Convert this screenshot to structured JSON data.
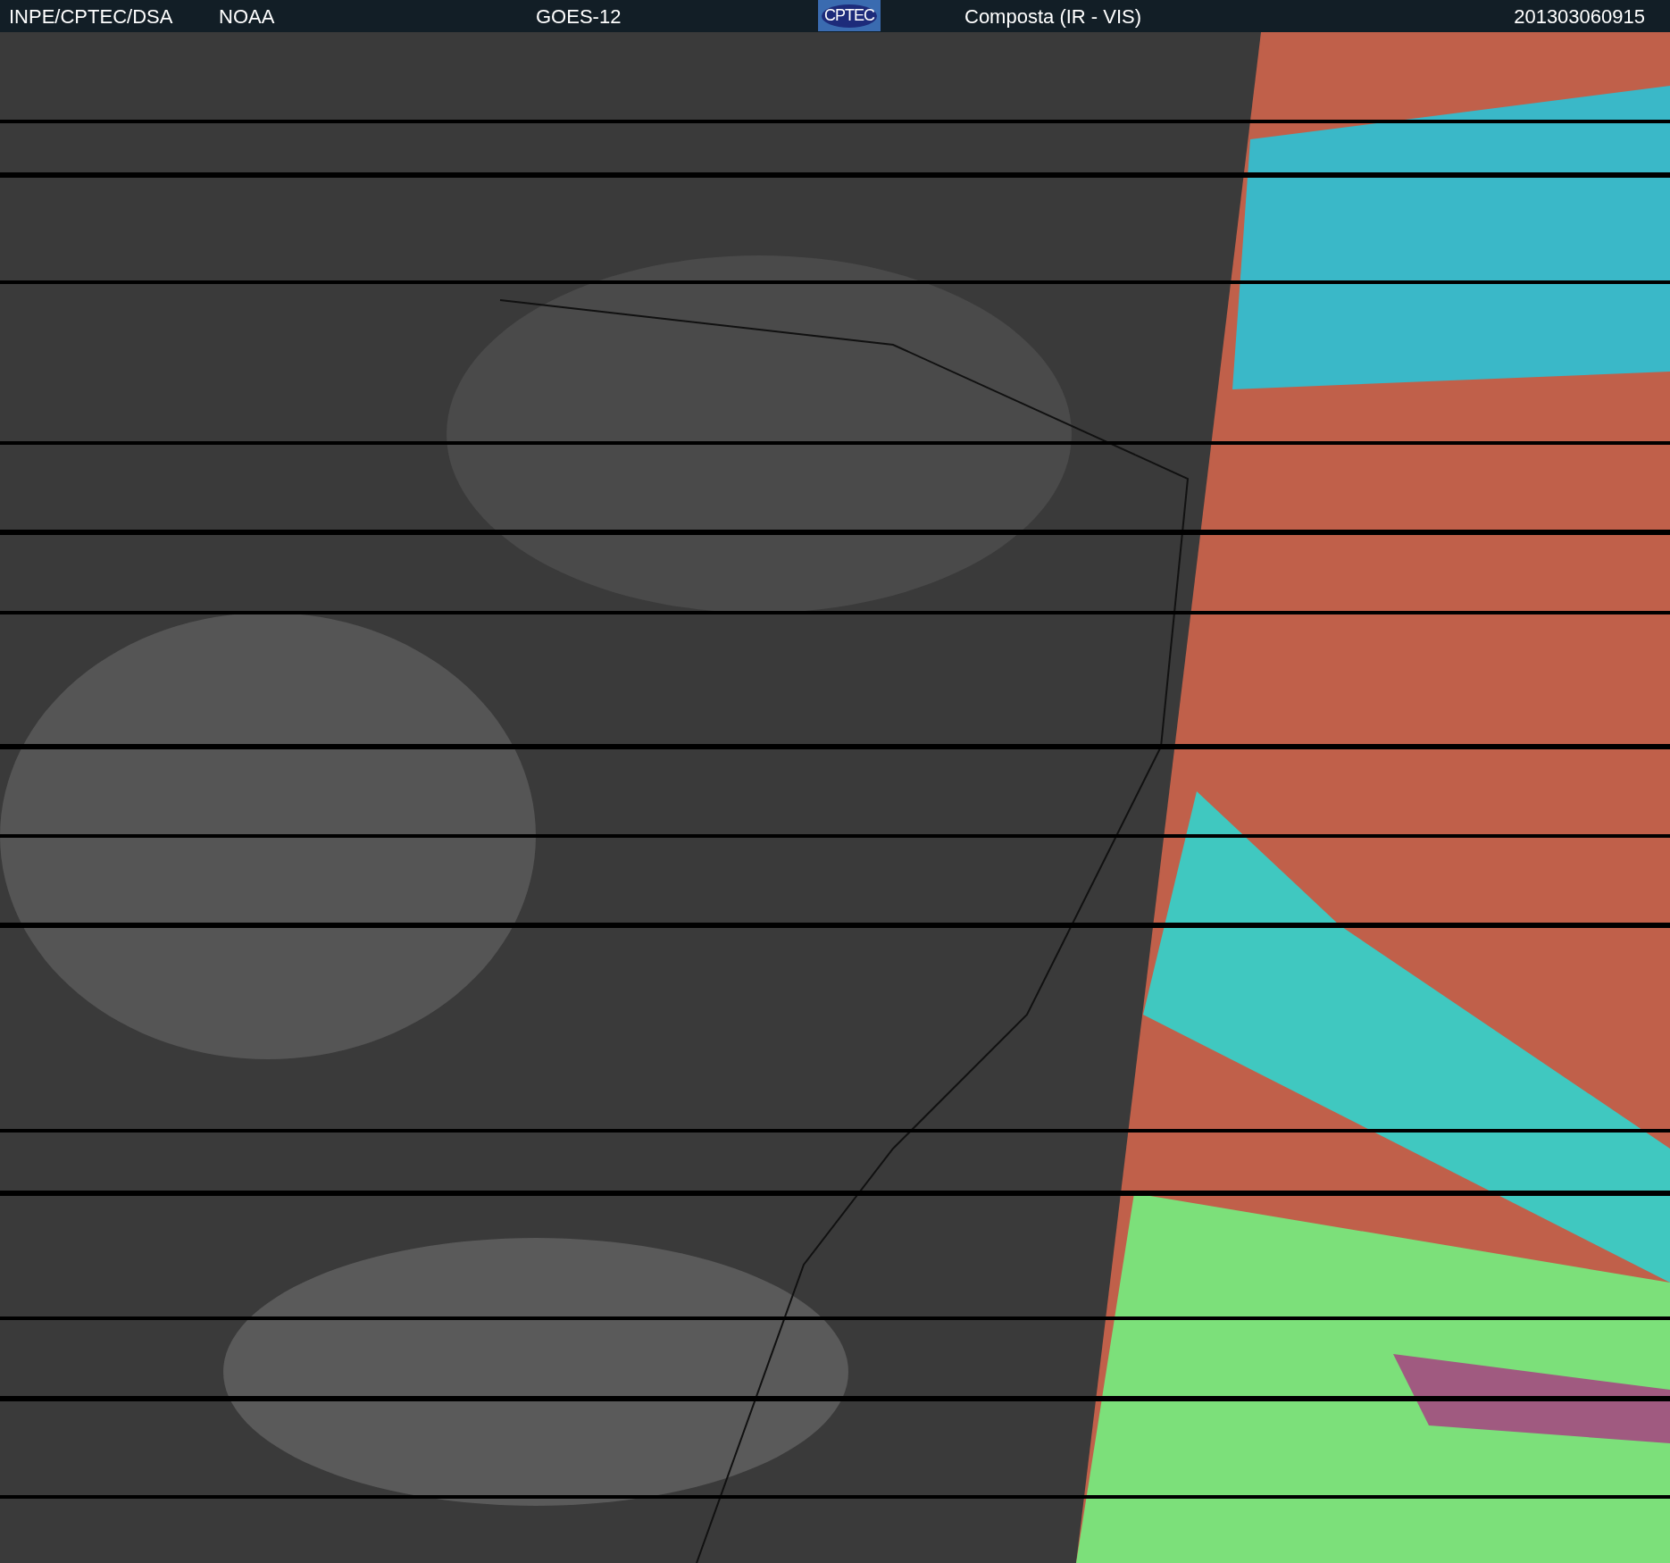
{
  "header": {
    "items": [
      {
        "kind": "text",
        "text": "INPE/CPTEC/DSA"
      },
      {
        "kind": "text",
        "text": "NOAA"
      },
      {
        "kind": "text",
        "text": "GOES-12"
      },
      {
        "kind": "logo",
        "text": "CPTEC"
      },
      {
        "kind": "text",
        "text": "Composta (IR - VIS)"
      },
      {
        "kind": "text",
        "text": "201303060915"
      }
    ]
  }
}
